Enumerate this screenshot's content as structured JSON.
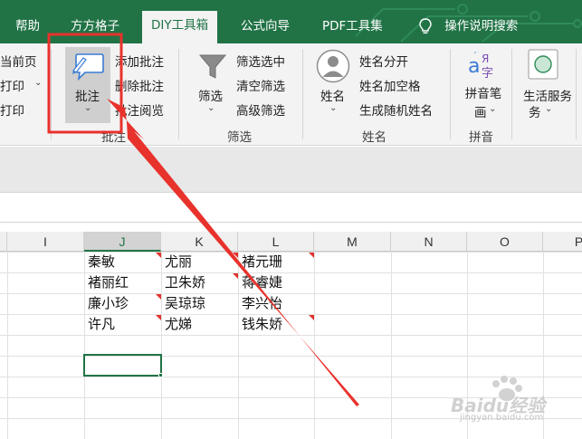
{
  "tabs": {
    "help": "帮助",
    "fangfang": "方方格子",
    "diy": "DIY工具箱",
    "formula": "公式向导",
    "pdf": "PDF工具集",
    "search": "操作说明搜索"
  },
  "ribbon": {
    "print": {
      "current_page": "当前页",
      "print": "打印",
      "print2": "打印"
    },
    "comment": {
      "big_button": "批注",
      "add": "添加批注",
      "delete": "删除批注",
      "browse": "批注阅览",
      "group": "批注"
    },
    "filter": {
      "big_button": "筛选",
      "filter_selected": "筛选选中",
      "clear_filter": "清空筛选",
      "advanced_filter": "高级筛选",
      "group": "筛选"
    },
    "name": {
      "big_button": "姓名",
      "split": "姓名分开",
      "add_space": "姓名加空格",
      "random": "生成随机姓名",
      "group": "姓名"
    },
    "pinyin": {
      "big_button": "拼音笔画",
      "group": "拼音"
    },
    "life": {
      "big_button": "生活服务"
    }
  },
  "columns": [
    "I",
    "J",
    "K",
    "L",
    "M",
    "N",
    "O",
    "P"
  ],
  "selected_column": "J",
  "table": {
    "rows": [
      [
        "秦敏",
        "尤丽",
        "褚元珊"
      ],
      [
        "褚丽红",
        "卫朱娇",
        "蒋睿婕"
      ],
      [
        "廉小珍",
        "吴琼琼",
        "李兴怡"
      ],
      [
        "许凡",
        "尤娣",
        "钱朱娇"
      ]
    ]
  },
  "watermark": {
    "brand": "Baidu经验",
    "url": "jingyan.baidu.com"
  },
  "colors": {
    "excel_green": "#217346",
    "annotation_red": "#e8322c",
    "comment_marker": "#e0322c"
  }
}
